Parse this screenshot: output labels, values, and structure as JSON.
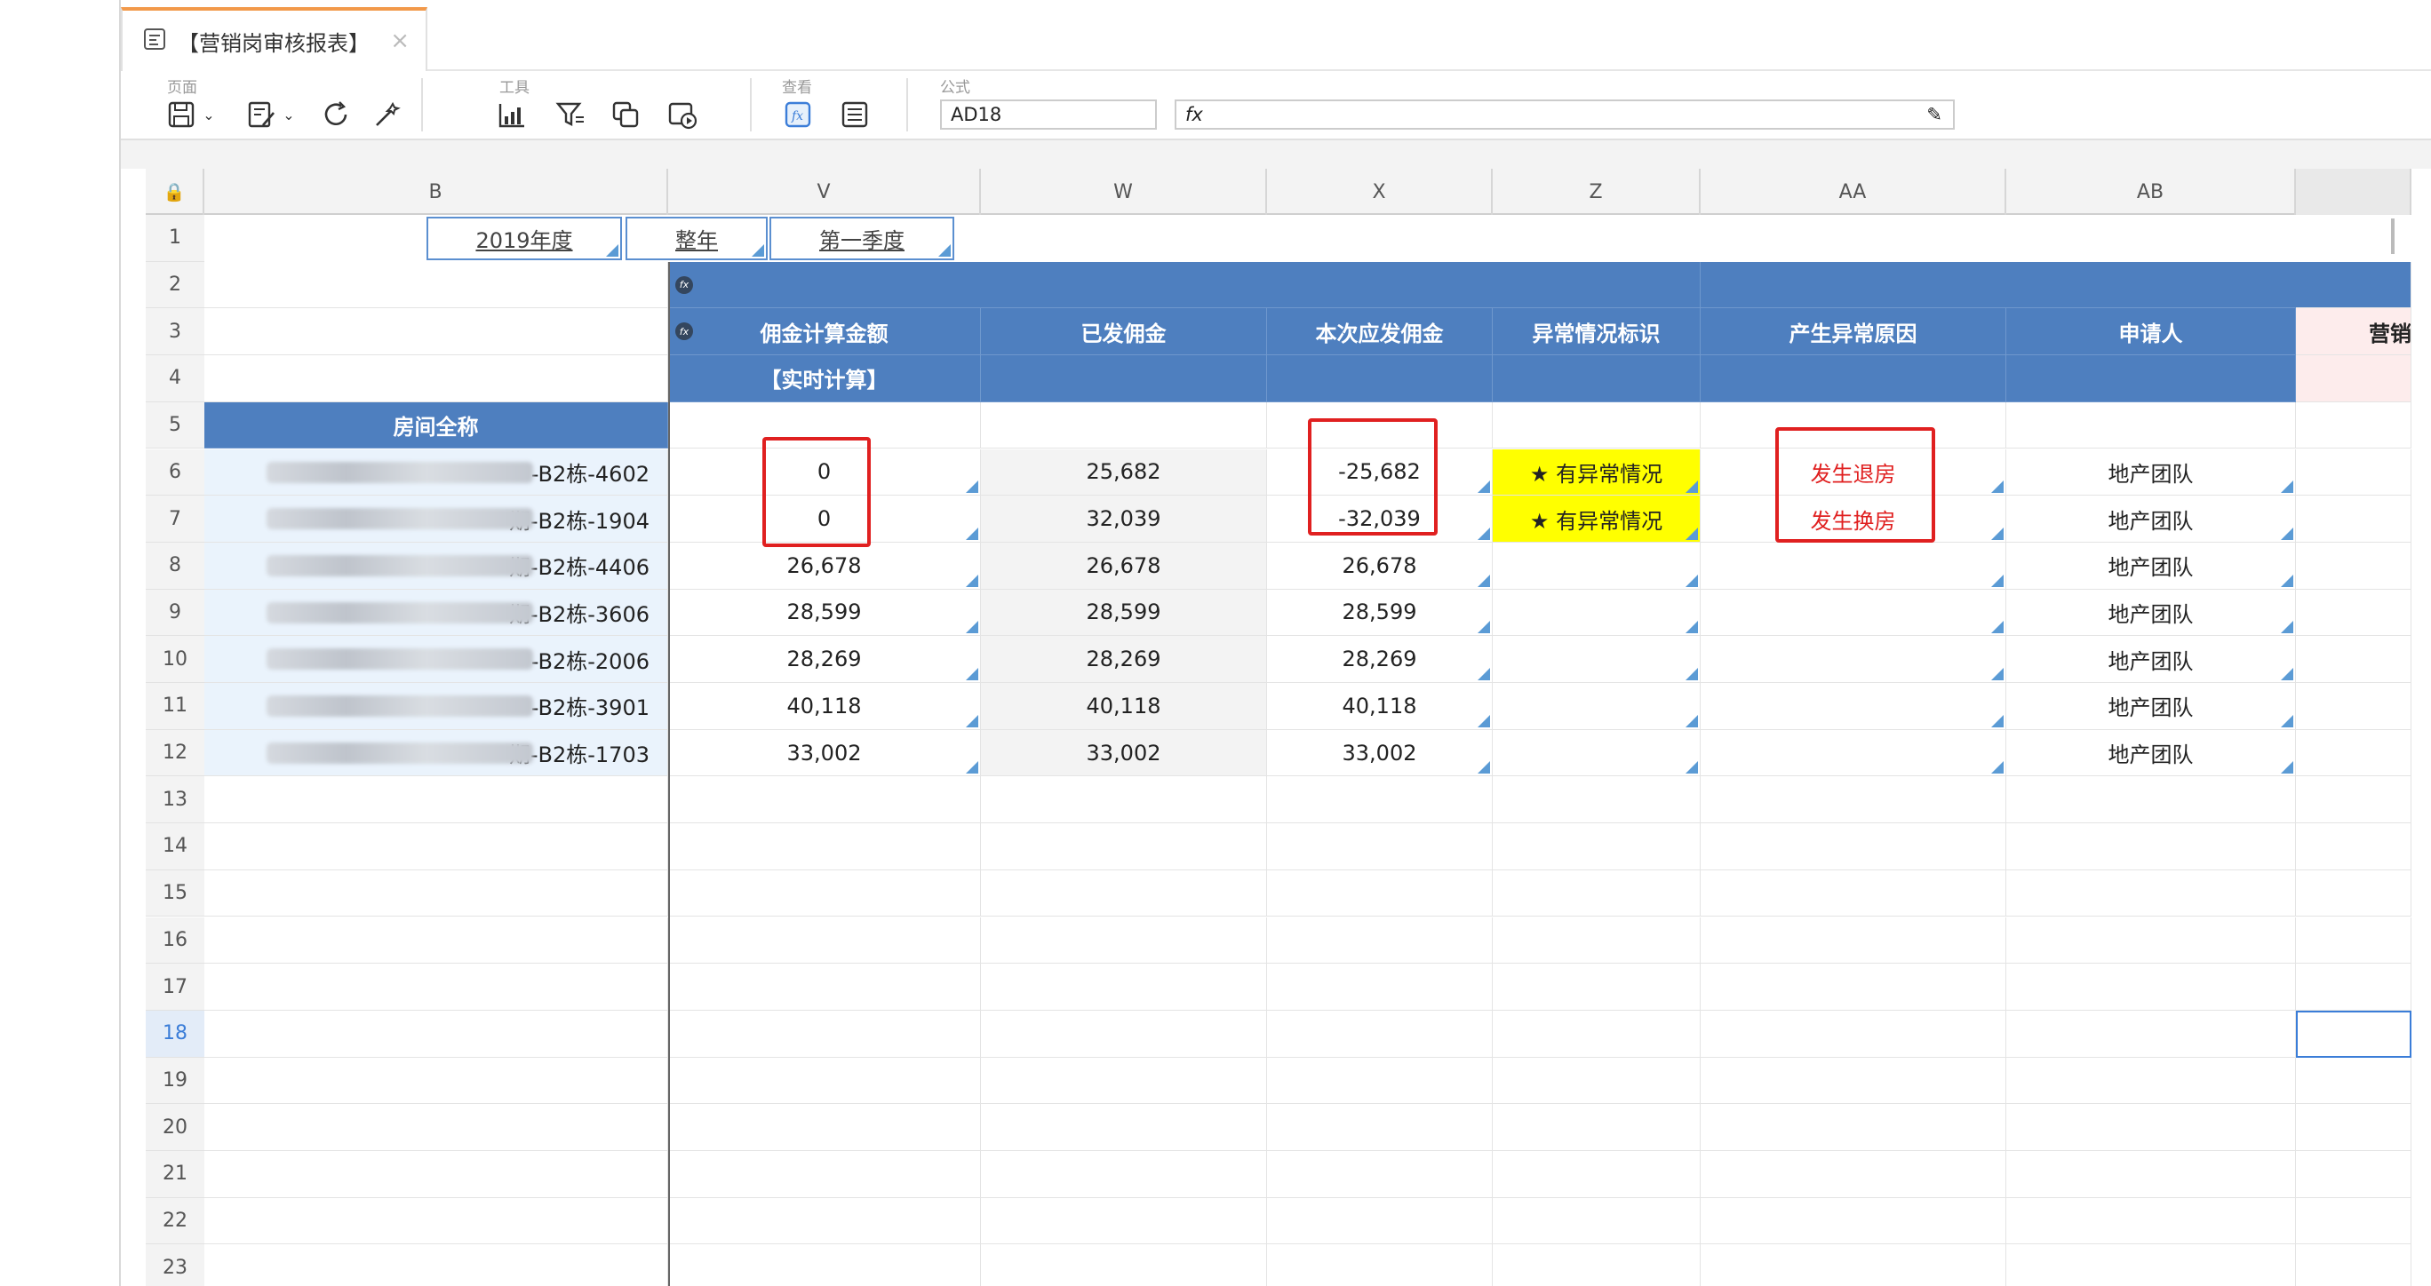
{
  "tab": {
    "title": "【营销岗审核报表】",
    "close": "×"
  },
  "toolbar": {
    "groups": {
      "page": "页面",
      "tools": "工具",
      "view": "查看",
      "formula": "公式"
    },
    "cell_ref": "AD18",
    "fx": "fx"
  },
  "columns": [
    "B",
    "V",
    "W",
    "X",
    "Z",
    "AA",
    "AB"
  ],
  "rows": [
    "1",
    "2",
    "3",
    "4",
    "5",
    "6",
    "7",
    "8",
    "9",
    "10",
    "11",
    "12",
    "13",
    "14",
    "15",
    "16",
    "17",
    "18",
    "19",
    "20",
    "21",
    "22",
    "23"
  ],
  "params": {
    "year": "2019年度",
    "period": "整年",
    "quarter": "第一季度"
  },
  "headers": {
    "commission_calc": "佣金计算金额",
    "realtime": "【实时计算】",
    "paid": "已发佣金",
    "this_pay": "本次应发佣金",
    "abnormal_flag": "异常情况标识",
    "abnormal_reason": "产生异常原因",
    "applicant": "申请人",
    "next": "营销",
    "room_name": "房间全称"
  },
  "data_rows": [
    {
      "room": "-B2栋-4602",
      "calc": "0",
      "paid": "25,682",
      "this": "-25,682",
      "flag": "★ 有异常情况",
      "reason": "发生退房",
      "applicant": "地产团队"
    },
    {
      "room": "期-B2栋-1904",
      "calc": "0",
      "paid": "32,039",
      "this": "-32,039",
      "flag": "★ 有异常情况",
      "reason": "发生换房",
      "applicant": "地产团队"
    },
    {
      "room": "期-B2栋-4406",
      "calc": "26,678",
      "paid": "26,678",
      "this": "26,678",
      "flag": "",
      "reason": "",
      "applicant": "地产团队"
    },
    {
      "room": "期-B2栋-3606",
      "calc": "28,599",
      "paid": "28,599",
      "this": "28,599",
      "flag": "",
      "reason": "",
      "applicant": "地产团队"
    },
    {
      "room": "-B2栋-2006",
      "calc": "28,269",
      "paid": "28,269",
      "this": "28,269",
      "flag": "",
      "reason": "",
      "applicant": "地产团队"
    },
    {
      "room": "-B2栋-3901",
      "calc": "40,118",
      "paid": "40,118",
      "this": "40,118",
      "flag": "",
      "reason": "",
      "applicant": "地产团队"
    },
    {
      "room": "期-B2栋-1703",
      "calc": "33,002",
      "paid": "33,002",
      "this": "33,002",
      "flag": "",
      "reason": "",
      "applicant": "地产团队"
    }
  ],
  "colors": {
    "header_blue": "#4e7fbf",
    "flag_yellow": "#ffff00",
    "reason_red": "#e02020",
    "highlight_box": "#e02020"
  }
}
